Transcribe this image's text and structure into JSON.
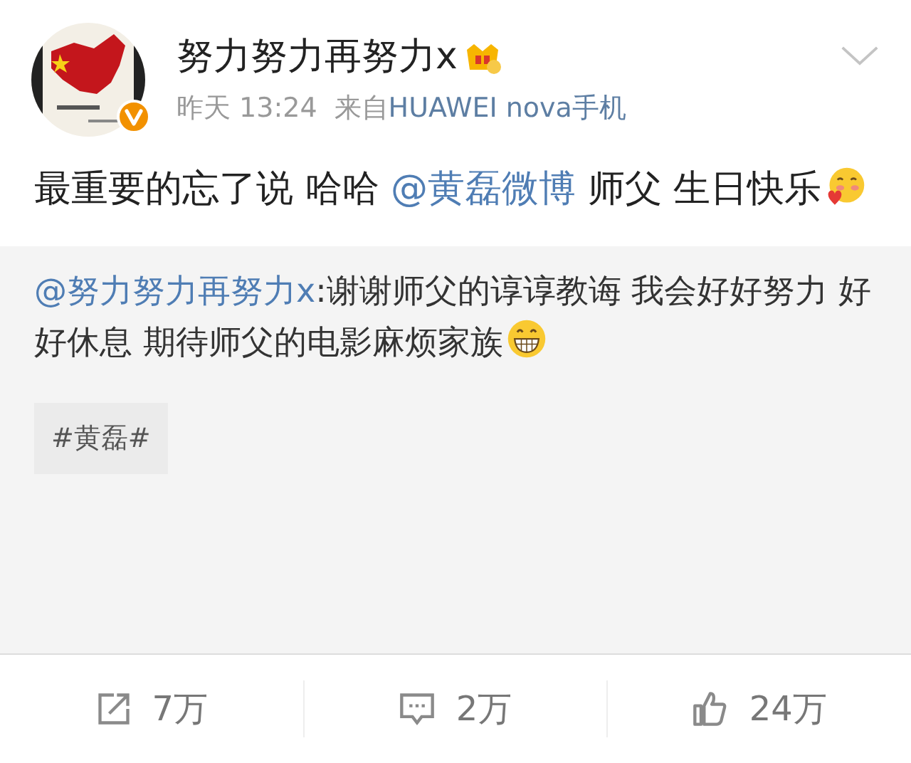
{
  "post": {
    "author": "努力努力再努力x",
    "time": "昨天 13:24",
    "source_prefix": "来自",
    "source": "HUAWEI nova手机",
    "text": [
      {
        "kind": "plain",
        "text": "最重要的忘了说 哈哈 "
      },
      {
        "kind": "mention",
        "text": "@黄磊微博"
      },
      {
        "kind": "plain",
        "text": " 师父 生日快乐"
      }
    ]
  },
  "repost": {
    "text": [
      {
        "kind": "mention",
        "text": "@努力努力再努力x"
      },
      {
        "kind": "plain",
        "text": ":谢谢师父的谆谆教诲 我会好好努力 好好休息 期待师父的电影麻烦家族"
      }
    ]
  },
  "topic": "#黄磊#",
  "actions": [
    {
      "kind": "share",
      "count": "7万"
    },
    {
      "kind": "comment",
      "count": "2万"
    },
    {
      "kind": "like",
      "count": "24万"
    }
  ]
}
